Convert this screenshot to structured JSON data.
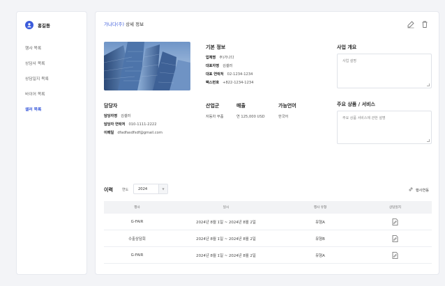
{
  "sidebar": {
    "user_name": "홍길동",
    "items": [
      {
        "label": "행사 목록"
      },
      {
        "label": "상담사 목록"
      },
      {
        "label": "상담일지 목록"
      },
      {
        "label": "바이어 목록"
      },
      {
        "label": "셀러 목록",
        "active": true
      }
    ]
  },
  "header": {
    "company": "가나다(주)",
    "suffix": " 상세 정보"
  },
  "basic_info": {
    "title": "기본 정보",
    "fields": [
      {
        "k": "업체명",
        "v": "주)가나다"
      },
      {
        "k": "대표자명",
        "v": "김셀러"
      },
      {
        "k": "대표 연락처",
        "v": "02-1234-1234"
      },
      {
        "k": "팩스번호",
        "v": "+822-1234-1234"
      }
    ]
  },
  "business": {
    "title": "사업 개요",
    "placeholder": "사업 설명"
  },
  "manager": {
    "title": "담당자",
    "fields": [
      {
        "k": "담당자명",
        "v": "김셀러"
      },
      {
        "k": "담당자 연락처",
        "v": "010-1111-2222"
      },
      {
        "k": "이메일",
        "v": "dfadfasdfsdf@gmail.com"
      }
    ]
  },
  "industry": {
    "title": "산업군",
    "value": "자동차 부품"
  },
  "sales": {
    "title": "매출",
    "value": "연 125,000 USD"
  },
  "language": {
    "title": "가능언어",
    "value": "한국어"
  },
  "products": {
    "title": "주요 상품 / 서비스",
    "placeholder": "주요 상품 서비스에 관한 설명"
  },
  "history": {
    "title": "이력",
    "year_label": "연도",
    "year_value": "2024",
    "link_label": "행사연동",
    "columns": [
      "행사",
      "일시",
      "행사 유형",
      "상담일지"
    ],
    "rows": [
      {
        "event": "G-FAIR",
        "date": "2024년 8월 1일 ~ 2024년 8월 2일",
        "type": "유형A"
      },
      {
        "event": "수출상담회",
        "date": "2024년 8월 1일 ~ 2024년 8월 2일",
        "type": "유형B"
      },
      {
        "event": "G-FAIR",
        "date": "2024년 8월 1일 ~ 2024년 8월 2일",
        "type": "유형A"
      }
    ]
  },
  "colors": {
    "accent": "#3b5bdb",
    "border": "#e6e8ee",
    "bg": "#f3f4f7"
  },
  "icons": [
    "user-icon",
    "edit-icon",
    "trash-icon",
    "link-icon",
    "document-icon",
    "chevron-down-icon"
  ]
}
